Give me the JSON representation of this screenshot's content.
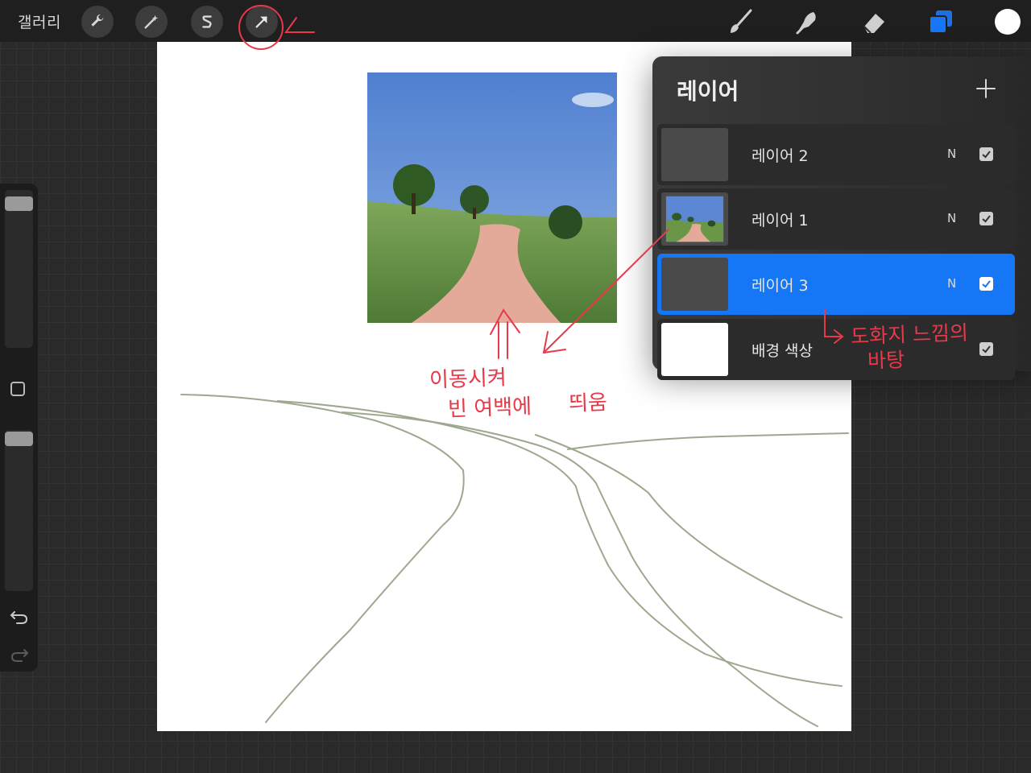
{
  "topbar": {
    "gallery_label": "갤러리",
    "left_tools": [
      "wrench-icon",
      "magic-wand-icon",
      "selection-icon",
      "move-arrow-icon"
    ],
    "right_tools": [
      "brush-icon",
      "smudge-icon",
      "eraser-icon",
      "layers-icon",
      "color-swatch"
    ]
  },
  "layers_panel": {
    "title": "레이어",
    "layers": [
      {
        "name": "레이어 2",
        "mode": "N",
        "visible": true,
        "selected": false
      },
      {
        "name": "레이어 1",
        "mode": "N",
        "visible": true,
        "selected": false
      },
      {
        "name": "레이어 3",
        "mode": "N",
        "visible": true,
        "selected": true
      },
      {
        "name": "배경 색상",
        "mode": "",
        "visible": true,
        "selected": false
      }
    ]
  },
  "annotations": {
    "move_note_line1": "이동시켜",
    "move_note_line2": "빈 여백에",
    "float_note": "띄움",
    "paper_note_line1": "도화지 느낌의",
    "paper_note_line2": "바탕"
  },
  "colors": {
    "accent": "#1577f5",
    "annotation": "#e8394a",
    "canvas": "#ffffff"
  }
}
